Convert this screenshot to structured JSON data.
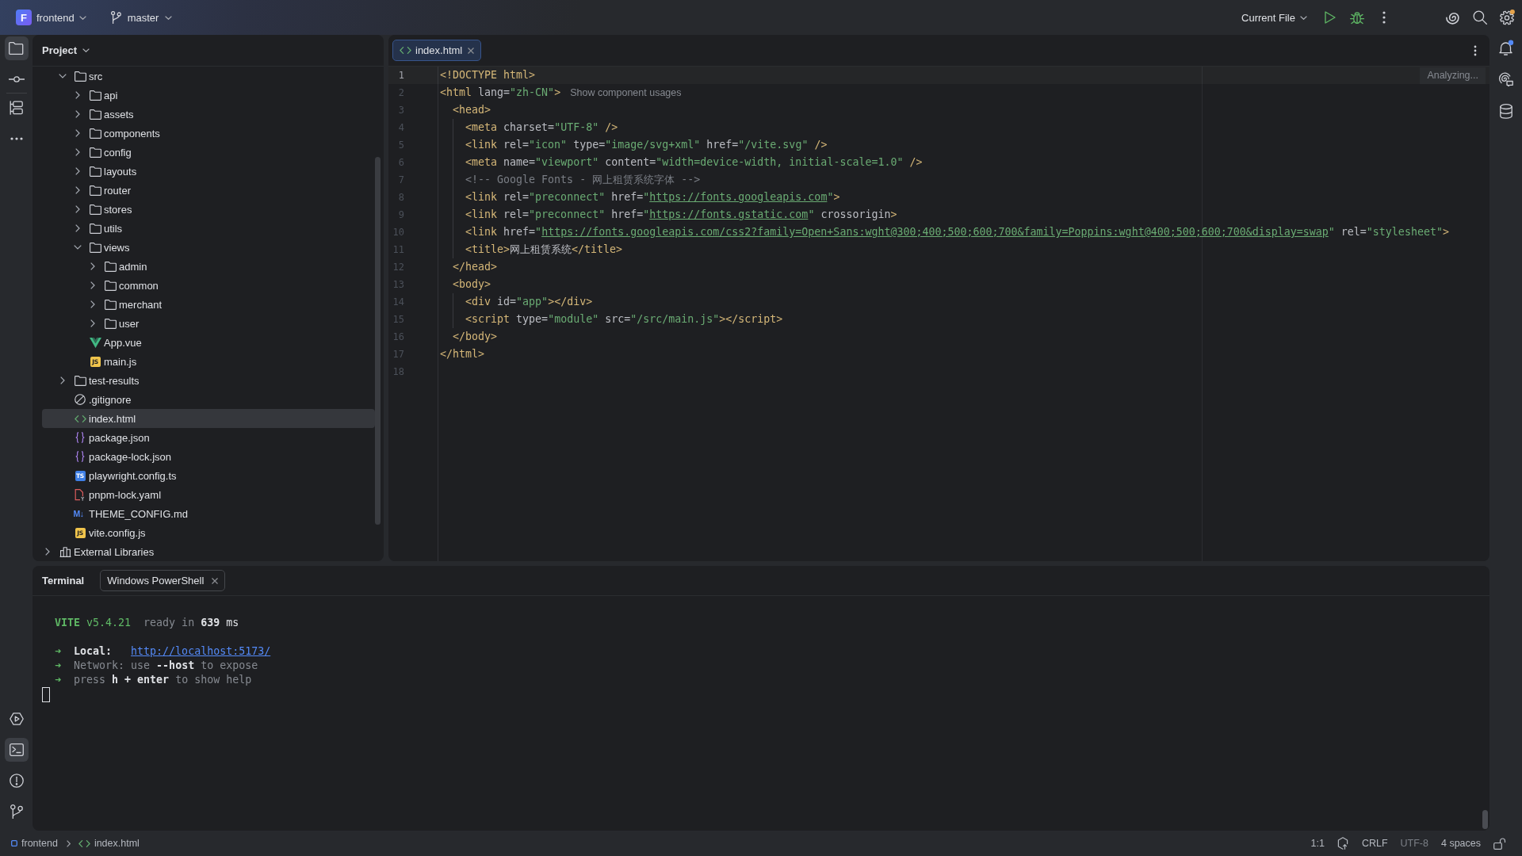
{
  "title_bar": {
    "project": {
      "initial": "F",
      "name": "frontend"
    },
    "branch": {
      "name": "master"
    },
    "run_config": {
      "label": "Current File"
    },
    "run_actions": [
      {
        "kind": "run"
      },
      {
        "kind": "debug"
      },
      {
        "kind": "more"
      }
    ],
    "tools": [
      {
        "kind": "assistant",
        "badge": false
      },
      {
        "kind": "search",
        "badge": false
      },
      {
        "kind": "settings",
        "badge": true
      }
    ]
  },
  "left_toolbar": {
    "top_groups": [
      [
        {
          "kind": "project",
          "selected": true
        },
        {
          "kind": "commit",
          "selected": false
        }
      ],
      [
        {
          "kind": "structure",
          "selected": false
        },
        {
          "kind": "more",
          "selected": false
        }
      ]
    ],
    "bottom": [
      {
        "kind": "run",
        "selected": false
      },
      {
        "kind": "terminal",
        "selected": true
      },
      {
        "kind": "problems",
        "selected": false
      },
      {
        "kind": "git",
        "selected": false
      }
    ]
  },
  "project_panel": {
    "title": "Project",
    "tree": [
      {
        "children": [
          {
            "label": "src",
            "kind": "folder",
            "expanded": true,
            "selected": false,
            "children": [
              {
                "label": "api",
                "kind": "folder",
                "expanded": false,
                "selected": false
              },
              {
                "label": "assets",
                "kind": "folder",
                "expanded": false,
                "selected": false
              },
              {
                "label": "components",
                "kind": "folder",
                "expanded": false,
                "selected": false
              },
              {
                "label": "config",
                "kind": "folder",
                "expanded": false,
                "selected": false
              },
              {
                "label": "layouts",
                "kind": "folder",
                "expanded": false,
                "selected": false
              },
              {
                "label": "router",
                "kind": "folder",
                "expanded": false,
                "selected": false
              },
              {
                "label": "stores",
                "kind": "folder",
                "expanded": false,
                "selected": false
              },
              {
                "label": "utils",
                "kind": "folder",
                "expanded": false,
                "selected": false
              },
              {
                "label": "views",
                "kind": "folder",
                "expanded": true,
                "selected": false,
                "children": [
                  {
                    "label": "admin",
                    "kind": "folder",
                    "expanded": false,
                    "selected": false
                  },
                  {
                    "label": "common",
                    "kind": "folder",
                    "expanded": false,
                    "selected": false
                  },
                  {
                    "label": "merchant",
                    "kind": "folder",
                    "expanded": false,
                    "selected": false
                  },
                  {
                    "label": "user",
                    "kind": "folder",
                    "expanded": false,
                    "selected": false
                  }
                ]
              },
              {
                "label": "App.vue",
                "kind": "vue",
                "selected": false
              },
              {
                "label": "main.js",
                "kind": "js",
                "icon_label": "JS",
                "selected": false
              }
            ]
          },
          {
            "label": "test-results",
            "kind": "folder",
            "expanded": false,
            "selected": false
          },
          {
            "label": ".gitignore",
            "kind": "ignore",
            "selected": false
          },
          {
            "label": "index.html",
            "kind": "html",
            "selected": true
          },
          {
            "label": "package.json",
            "kind": "json",
            "selected": false
          },
          {
            "label": "package-lock.json",
            "kind": "json",
            "selected": false
          },
          {
            "label": "playwright.config.ts",
            "kind": "ts",
            "icon_label": "TS",
            "selected": false
          },
          {
            "label": "pnpm-lock.yaml",
            "kind": "yaml",
            "selected": false
          },
          {
            "label": "THEME_CONFIG.md",
            "kind": "md",
            "icon_label": "M↓",
            "selected": false
          },
          {
            "label": "vite.config.js",
            "kind": "js",
            "icon_label": "JS",
            "selected": false
          }
        ]
      },
      {
        "label": "External Libraries",
        "kind": "library",
        "expanded": false,
        "selected": false
      }
    ]
  },
  "editor": {
    "tabs": [
      {
        "kind": "html",
        "label": "index.html",
        "selected": true
      }
    ],
    "status": "Analyzing...",
    "lines": [
      {
        "number": "1",
        "current": true,
        "tokens": [
          {
            "kind": "tag",
            "text": "<!DOCTYPE html>"
          }
        ]
      },
      {
        "number": "2",
        "current": false,
        "tokens": [
          {
            "kind": "tag",
            "text": "<html"
          },
          {
            "kind": "attr",
            "text": " lang="
          },
          {
            "kind": "value",
            "text": "\"zh-CN\""
          },
          {
            "kind": "tag",
            "text": ">"
          }
        ],
        "hint": "Show component usages"
      },
      {
        "number": "3",
        "current": false,
        "tokens": [
          {
            "kind": "tag",
            "text": "  <head>"
          }
        ]
      },
      {
        "number": "4",
        "current": false,
        "tokens": [
          {
            "kind": "tag",
            "text": "    <meta"
          },
          {
            "kind": "attr",
            "text": " charset="
          },
          {
            "kind": "value",
            "text": "\"UTF-8\""
          },
          {
            "kind": "tag",
            "text": " />"
          }
        ]
      },
      {
        "number": "5",
        "current": false,
        "tokens": [
          {
            "kind": "tag",
            "text": "    <link"
          },
          {
            "kind": "attr",
            "text": " rel="
          },
          {
            "kind": "value",
            "text": "\"icon\""
          },
          {
            "kind": "attr",
            "text": " type="
          },
          {
            "kind": "value",
            "text": "\"image/svg+xml\""
          },
          {
            "kind": "attr",
            "text": " href="
          },
          {
            "kind": "value",
            "text": "\"/vite.svg\""
          },
          {
            "kind": "tag",
            "text": " />"
          }
        ]
      },
      {
        "number": "6",
        "current": false,
        "tokens": [
          {
            "kind": "tag",
            "text": "    <meta"
          },
          {
            "kind": "attr",
            "text": " name="
          },
          {
            "kind": "value",
            "text": "\"viewport\""
          },
          {
            "kind": "attr",
            "text": " content="
          },
          {
            "kind": "value",
            "text": "\"width=device-width, initial-scale=1.0\""
          },
          {
            "kind": "tag",
            "text": " />"
          }
        ]
      },
      {
        "number": "7",
        "current": false,
        "tokens": [
          {
            "kind": "comment",
            "text": "    <!-- Google Fonts - 网上租赁系统字体 -->"
          }
        ]
      },
      {
        "number": "8",
        "current": false,
        "tokens": [
          {
            "kind": "tag",
            "text": "    <link"
          },
          {
            "kind": "attr",
            "text": " rel="
          },
          {
            "kind": "value",
            "text": "\"preconnect\""
          },
          {
            "kind": "attr",
            "text": " href="
          },
          {
            "kind": "value",
            "text": "\""
          },
          {
            "kind": "link",
            "text": "https://fonts.googleapis.com"
          },
          {
            "kind": "value",
            "text": "\""
          },
          {
            "kind": "tag",
            "text": ">"
          }
        ]
      },
      {
        "number": "9",
        "current": false,
        "tokens": [
          {
            "kind": "tag",
            "text": "    <link"
          },
          {
            "kind": "attr",
            "text": " rel="
          },
          {
            "kind": "value",
            "text": "\"preconnect\""
          },
          {
            "kind": "attr",
            "text": " href="
          },
          {
            "kind": "value",
            "text": "\""
          },
          {
            "kind": "link",
            "text": "https://fonts.gstatic.com"
          },
          {
            "kind": "value",
            "text": "\""
          },
          {
            "kind": "attr",
            "text": " crossorigin"
          },
          {
            "kind": "tag",
            "text": ">"
          }
        ]
      },
      {
        "number": "10",
        "current": false,
        "tokens": [
          {
            "kind": "tag",
            "text": "    <link"
          },
          {
            "kind": "attr",
            "text": " href="
          },
          {
            "kind": "value",
            "text": "\""
          },
          {
            "kind": "link",
            "text": "https://fonts.googleapis.com/css2?family=Open+Sans:wght@300;400;500;600;700&family=Poppins:wght@400;500;600;700&display=swap"
          },
          {
            "kind": "value",
            "text": "\""
          },
          {
            "kind": "attr",
            "text": " rel="
          },
          {
            "kind": "value",
            "text": "\"stylesheet\""
          },
          {
            "kind": "tag",
            "text": ">"
          }
        ]
      },
      {
        "number": "11",
        "current": false,
        "tokens": [
          {
            "kind": "tag",
            "text": "    <title>"
          },
          {
            "kind": "text",
            "text": "网上租赁系统"
          },
          {
            "kind": "tag",
            "text": "</title>"
          }
        ]
      },
      {
        "number": "12",
        "current": false,
        "tokens": [
          {
            "kind": "tag",
            "text": "  </head>"
          }
        ]
      },
      {
        "number": "13",
        "current": false,
        "tokens": [
          {
            "kind": "tag",
            "text": "  <body>"
          }
        ]
      },
      {
        "number": "14",
        "current": false,
        "tokens": [
          {
            "kind": "tag",
            "text": "    <div"
          },
          {
            "kind": "attr",
            "text": " id="
          },
          {
            "kind": "value",
            "text": "\"app\""
          },
          {
            "kind": "tag",
            "text": "></div>"
          }
        ]
      },
      {
        "number": "15",
        "current": false,
        "tokens": [
          {
            "kind": "tag",
            "text": "    <script"
          },
          {
            "kind": "attr",
            "text": " type="
          },
          {
            "kind": "value",
            "text": "\"module\""
          },
          {
            "kind": "attr",
            "text": " src="
          },
          {
            "kind": "value",
            "text": "\"/src/main.js\""
          },
          {
            "kind": "tag",
            "text": "></script>"
          }
        ]
      },
      {
        "number": "16",
        "current": false,
        "tokens": [
          {
            "kind": "tag",
            "text": "  </body>"
          }
        ]
      },
      {
        "number": "17",
        "current": false,
        "tokens": [
          {
            "kind": "tag",
            "text": "</html>"
          }
        ]
      },
      {
        "number": "18",
        "current": false
      }
    ]
  },
  "right_toolbar": [
    {
      "kind": "notifications",
      "badge": true
    },
    {
      "kind": "assistant",
      "badge": false
    },
    {
      "kind": "database",
      "badge": false
    }
  ],
  "terminal": {
    "title": "Terminal",
    "tabs": [
      {
        "label": "Windows PowerShell",
        "selected": true
      }
    ],
    "blocks": [
      {
        "lines": [
          {
            "tokens": [
              {
                "kind": "brand",
                "text": "VITE"
              },
              {
                "kind": "accent",
                "text": " v5.4.21"
              },
              {
                "kind": "dim",
                "text": "  ready in "
              },
              {
                "kind": "strong",
                "text": "639"
              },
              {
                "kind": "plain",
                "text": " ms"
              }
            ]
          }
        ]
      },
      {
        "lines": [
          {
            "tokens": [
              {
                "kind": "accent",
                "text": "➜"
              },
              {
                "kind": "strong",
                "text": "  Local:   "
              },
              {
                "kind": "link",
                "text": "http://localhost:5173/"
              }
            ]
          },
          {
            "tokens": [
              {
                "kind": "accent",
                "text": "➜"
              },
              {
                "kind": "dim",
                "text": "  Network: use "
              },
              {
                "kind": "strong",
                "text": "--host"
              },
              {
                "kind": "dim",
                "text": " to expose"
              }
            ]
          },
          {
            "tokens": [
              {
                "kind": "accent",
                "text": "➜"
              },
              {
                "kind": "dim",
                "text": "  press "
              },
              {
                "kind": "strong",
                "text": "h + enter"
              },
              {
                "kind": "dim",
                "text": " to show help"
              }
            ]
          }
        ]
      }
    ]
  },
  "status_bar": {
    "breadcrumbs": [
      {
        "kind": "module",
        "label": "frontend"
      },
      {
        "kind": "html",
        "label": "index.html"
      }
    ],
    "widgets": [
      {
        "kind": "text",
        "text": "1:1",
        "disabled": false
      },
      {
        "kind": "assistant",
        "disabled": false
      },
      {
        "kind": "text",
        "text": "CRLF",
        "disabled": false
      },
      {
        "kind": "text",
        "text": "UTF-8",
        "disabled": true
      },
      {
        "kind": "text",
        "text": "4 spaces",
        "disabled": false
      },
      {
        "kind": "lock",
        "disabled": false
      }
    ]
  }
}
